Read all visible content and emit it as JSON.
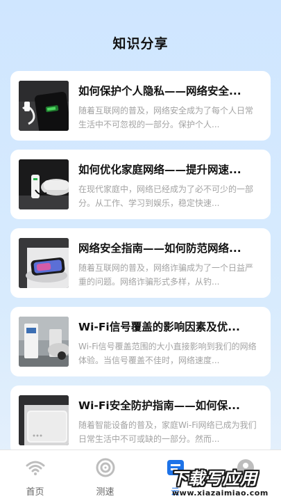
{
  "header": {
    "title": "知识分享"
  },
  "articles": [
    {
      "title": "如何保护个人隐私——网络安全...",
      "desc": "随着互联网的普及，网络安全成为了每个人日常生活中不可忽视的一部分。保护个人...",
      "image": "phone-charging-image"
    },
    {
      "title": "如何优化家庭网络——提升网速...",
      "desc": "在现代家庭中，网络已经成为了必不可少的一部分。从工作、学习到娱乐，稳定快速...",
      "image": "ev-charger-image"
    },
    {
      "title": "网络安全指南——如何防范网络...",
      "desc": "随着互联网的普及，网络诈骗成为了一个日益严重的问题。网络诈骗形式多样，从钓...",
      "image": "wireless-charger-image"
    },
    {
      "title": "Wi-Fi信号覆盖的影响因素及优...",
      "desc": "Wi-Fi信号覆盖范围的大小直接影响到我们的网络体验。当信号覆盖不佳时，网络速度...",
      "image": "charging-station-image"
    },
    {
      "title": "Wi-Fi安全防护指南——如何保...",
      "desc": "随着智能设备的普及，家庭Wi-Fi网络已成为我们日常生活中不可或缺的一部分。然而...",
      "image": "power-bank-image"
    }
  ],
  "tabbar": {
    "tabs": [
      {
        "label": "首页",
        "icon": "wifi-icon",
        "active": false
      },
      {
        "label": "测速",
        "icon": "speed-test-icon",
        "active": false
      },
      {
        "label": "云",
        "icon": "cloud-icon",
        "active": true
      },
      {
        "label": "",
        "icon": "profile-icon",
        "active": false
      }
    ]
  },
  "watermark": {
    "brand": "下载写应用",
    "url": "www.xiazaimiao.com"
  },
  "colors": {
    "accent": "#1e73e8",
    "background": "#d4e8fe",
    "card": "#ffffff"
  }
}
